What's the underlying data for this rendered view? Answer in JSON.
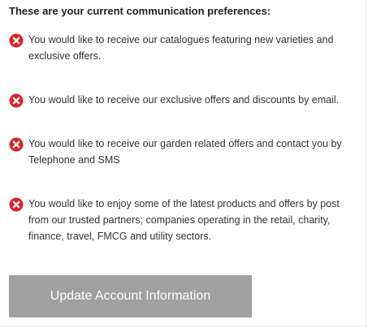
{
  "heading": "These are your current communication preferences:",
  "status_color": "#d9232e",
  "button_color": "#a0a0a0",
  "preferences": [
    {
      "icon": "cross-circle-icon",
      "status": "off",
      "text": "You would like to receive our catalogues featuring new varieties and exclusive offers."
    },
    {
      "icon": "cross-circle-icon",
      "status": "off",
      "text": "You would like to receive our exclusive offers and discounts by email."
    },
    {
      "icon": "cross-circle-icon",
      "status": "off",
      "text": "You would like to receive our garden related offers and contact you by Telephone and SMS"
    },
    {
      "icon": "cross-circle-icon",
      "status": "off",
      "text": "You would like to enjoy some of the latest products and offers by post from our trusted partners; companies operating in the retail, charity, finance, travel, FMCG and utility sectors."
    }
  ],
  "update_button_label": "Update Account Information"
}
